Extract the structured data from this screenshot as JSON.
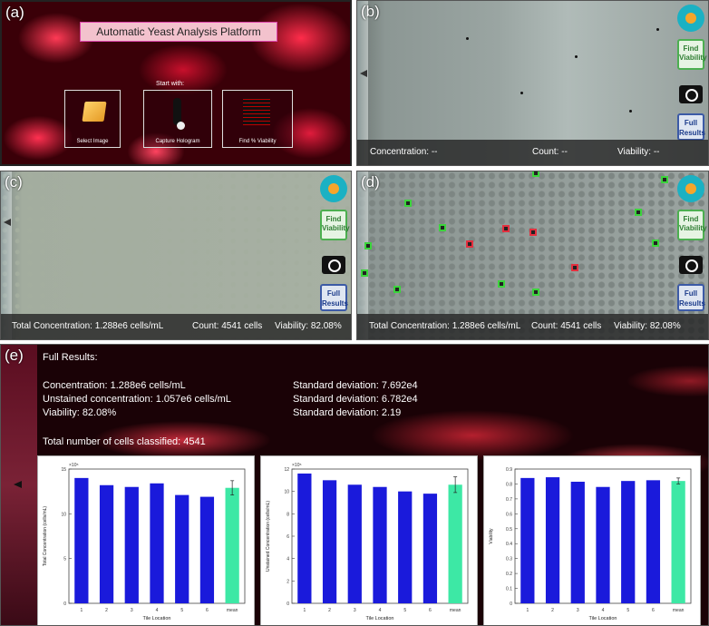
{
  "panel_labels": {
    "a": "(a)",
    "b": "(b)",
    "c": "(c)",
    "d": "(d)",
    "e": "(e)"
  },
  "panel_a": {
    "title": "Automatic Yeast Analysis Platform",
    "start_with": "Start with:",
    "buttons": [
      {
        "label": "Select Image",
        "icon": "folder-icon"
      },
      {
        "label": "Capture Hologram",
        "icon": "probe-icon"
      },
      {
        "label": "Find % Viability",
        "icon": "grid-icon"
      }
    ]
  },
  "sidebar": {
    "find_viability": [
      "Find",
      "Viability"
    ],
    "full_results": [
      "Full",
      "Results"
    ]
  },
  "panel_b": {
    "concentration": "Concentration: --",
    "count": "Count: --",
    "viability": "Viability: --"
  },
  "panel_c": {
    "concentration": "Total Concentration: 1.288e6 cells/mL",
    "count": "Count: 4541 cells",
    "viability": "Viability: 82.08%"
  },
  "panel_d": {
    "concentration": "Total Concentration: 1.288e6 cells/mL",
    "count": "Count: 4541 cells",
    "viability": "Viability: 82.08%"
  },
  "results": {
    "heading": "Full Results:",
    "rows": [
      {
        "label": "Concentration: 1.288e6 cells/mL",
        "sd": "Standard deviation: 7.692e4"
      },
      {
        "label": "Unstained concentration: 1.057e6 cells/mL",
        "sd": "Standard deviation: 6.782e4"
      },
      {
        "label": "Viability: 82.08%",
        "sd": "Standard deviation: 2.19"
      }
    ],
    "total": "Total number of cells classified: 4541"
  },
  "chart_data": [
    {
      "type": "bar",
      "categories": [
        "1",
        "2",
        "3",
        "4",
        "5",
        "6",
        "mean"
      ],
      "values": [
        14.0,
        13.2,
        13.0,
        13.4,
        12.1,
        11.9,
        12.9
      ],
      "mean_error": 0.8,
      "ylim": [
        0,
        15
      ],
      "yticks": [
        0,
        5,
        10,
        15
      ],
      "ylabel": "Total Concentration (cells/mL)",
      "xlabel": "Tile Location",
      "exponent": "×10⁵"
    },
    {
      "type": "bar",
      "categories": [
        "1",
        "2",
        "3",
        "4",
        "5",
        "6",
        "mean"
      ],
      "values": [
        11.6,
        11.0,
        10.6,
        10.4,
        10.0,
        9.8,
        10.6
      ],
      "mean_error": 0.7,
      "ylim": [
        0,
        12
      ],
      "yticks": [
        0,
        2,
        4,
        6,
        8,
        10,
        12
      ],
      "ylabel": "Unstained Concentration (cells/mL)",
      "xlabel": "Tile Location",
      "exponent": "×10⁵"
    },
    {
      "type": "bar",
      "categories": [
        "1",
        "2",
        "3",
        "4",
        "5",
        "6",
        "mean"
      ],
      "values": [
        0.84,
        0.845,
        0.815,
        0.78,
        0.82,
        0.825,
        0.82
      ],
      "mean_error": 0.02,
      "ylim": [
        0,
        0.9
      ],
      "yticks": [
        0,
        0.1,
        0.2,
        0.3,
        0.4,
        0.5,
        0.6,
        0.7,
        0.8,
        0.9
      ],
      "ylabel": "Viability",
      "xlabel": "Tile Location",
      "exponent": ""
    }
  ],
  "colors": {
    "bar": "#1a1adb",
    "mean_bar": "#3de8a5",
    "green_box": "#3cd43c",
    "red_box": "#e3303f"
  }
}
